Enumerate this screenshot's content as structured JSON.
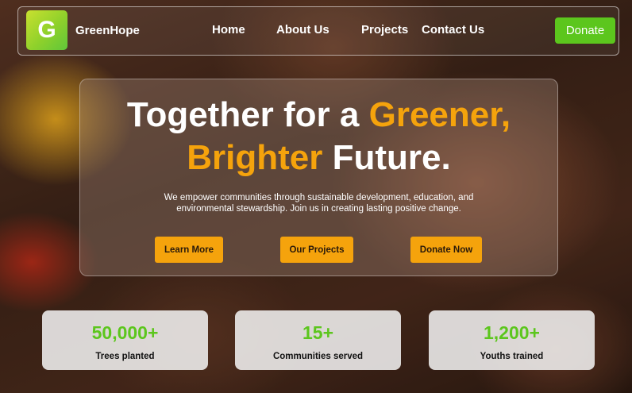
{
  "brand": {
    "logo_letter": "G",
    "name": "GreenHope"
  },
  "nav": {
    "links": [
      "Home",
      "About Us",
      "Projects",
      "Contact Us"
    ],
    "donate_label": "Donate"
  },
  "hero": {
    "headline_part1": "Together for a ",
    "headline_accent1": "Greener,",
    "headline_accent2": "Brighter",
    "headline_part2": " Future.",
    "description": "We empower communities through sustainable development, education, and environmental stewardship. Join us in creating lasting positive change.",
    "buttons": [
      "Learn More",
      "Our Projects",
      "Donate Now"
    ]
  },
  "stats": [
    {
      "value": "50,000+",
      "label": "Trees planted"
    },
    {
      "value": "15+",
      "label": "Communities served"
    },
    {
      "value": "1,200+",
      "label": "Youths trained"
    }
  ],
  "colors": {
    "accent_orange": "#f5a30c",
    "brand_green": "#5cc61d"
  }
}
